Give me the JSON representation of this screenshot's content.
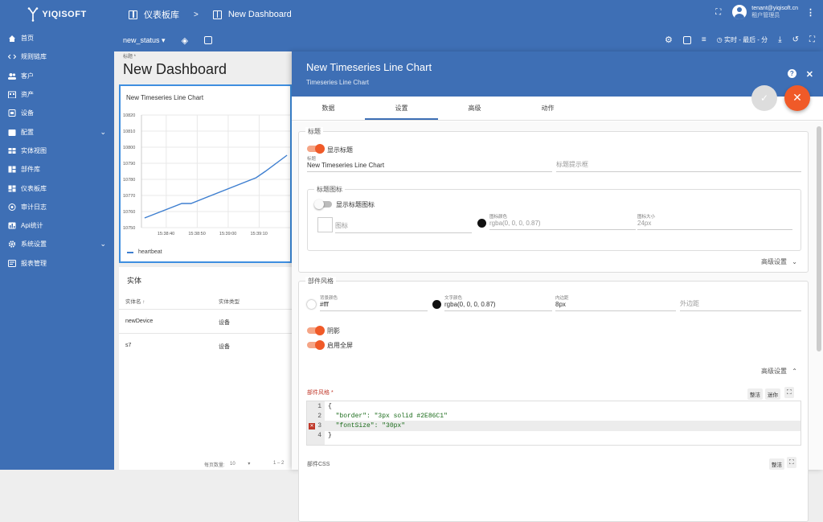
{
  "app": {
    "brand": "YIQISOFT"
  },
  "sidebar": {
    "items": [
      {
        "label": "首页"
      },
      {
        "label": "规则链库"
      },
      {
        "label": "客户"
      },
      {
        "label": "资产"
      },
      {
        "label": "设备"
      },
      {
        "label": "配置"
      },
      {
        "label": "实体视图"
      },
      {
        "label": "部件库"
      },
      {
        "label": "仪表板库"
      },
      {
        "label": "审计日志"
      },
      {
        "label": "Api统计"
      },
      {
        "label": "系统设置"
      },
      {
        "label": "报表管理"
      }
    ]
  },
  "topbar": {
    "crumb1": "仪表板库",
    "crumb_sep": ">",
    "crumb2": "New Dashboard",
    "user_email": "tenant@yiqisoft.cn",
    "user_role": "租户管理员"
  },
  "toolbar": {
    "state_select": "new_status",
    "timewindow": "实时 - 最后 - 分"
  },
  "dashboard": {
    "title_label": "标题 *",
    "title": "New Dashboard",
    "chart_title": "New Timeseries Line Chart",
    "entity_title": "实体",
    "entity_col1": "实体名 ↑",
    "entity_col2": "实体类型",
    "entities": [
      {
        "name": "newDevice",
        "type": "设备"
      },
      {
        "name": "s7",
        "type": "设备"
      }
    ],
    "pager_label": "每页数量:",
    "pager_size": "10",
    "pager_range": "1 – 2"
  },
  "chart_data": {
    "type": "line",
    "series": [
      {
        "name": "heartbeat",
        "color": "#3e7fd0"
      }
    ],
    "y_ticks": [
      "10820",
      "10810",
      "10800",
      "10790",
      "10780",
      "10770",
      "10760",
      "10750"
    ],
    "x_ticks": [
      "15:38:40",
      "15:38:50",
      "15:39:00",
      "15:39:10"
    ],
    "ylim": [
      10750,
      10820
    ],
    "x": [
      "15:38:33",
      "15:38:45",
      "15:38:48",
      "15:39:09",
      "15:39:12",
      "15:39:19"
    ],
    "y": [
      10756,
      10765,
      10765,
      10781,
      10785,
      10795
    ]
  },
  "panel": {
    "title": "New Timeseries Line Chart",
    "subtitle": "Timeseries Line Chart",
    "help": "?",
    "close": "✕",
    "ok": "✓",
    "cancel": "✕",
    "tabs": [
      "数据",
      "设置",
      "高级",
      "动作"
    ],
    "title_section": {
      "legend": "标题",
      "show_title": "显示标题",
      "title_label": "标题",
      "title_value": "New Timeseries Line Chart",
      "tooltip_placeholder": "标题提示框",
      "icon_legend": "标题图标",
      "show_icon": "显示标题图标",
      "icon_placeholder": "图标",
      "icon_color_label": "图标颜色",
      "icon_color_value": "rgba(0, 0, 0, 0.87)",
      "icon_size_label": "图标大小",
      "icon_size_value": "24px",
      "advanced": "高级设置"
    },
    "style_section": {
      "legend": "部件风格",
      "bg_label": "背景颜色",
      "bg_value": "#fff",
      "text_color_label": "文字颜色",
      "text_color_value": "rgba(0, 0, 0, 0.87)",
      "padding_label": "内边距",
      "padding_value": "8px",
      "margin_placeholder": "外边距",
      "shadow": "阴影",
      "fullscreen": "启用全屏",
      "advanced": "高级设置",
      "widget_style_label": "部件风格 *",
      "tidy": "整洁",
      "mini": "迷你",
      "css_label": "部件CSS",
      "css_tidy": "整洁",
      "code_lines": [
        {
          "n": "1",
          "text": "{"
        },
        {
          "n": "2",
          "text": "  \"border\": \"3px solid #2E86C1\""
        },
        {
          "n": "3",
          "text": "  \"fontSize\": \"30px\""
        },
        {
          "n": "4",
          "text": "}"
        }
      ]
    }
  },
  "colors": {
    "primary": "#3e6fb5",
    "accent": "#f05a28"
  }
}
